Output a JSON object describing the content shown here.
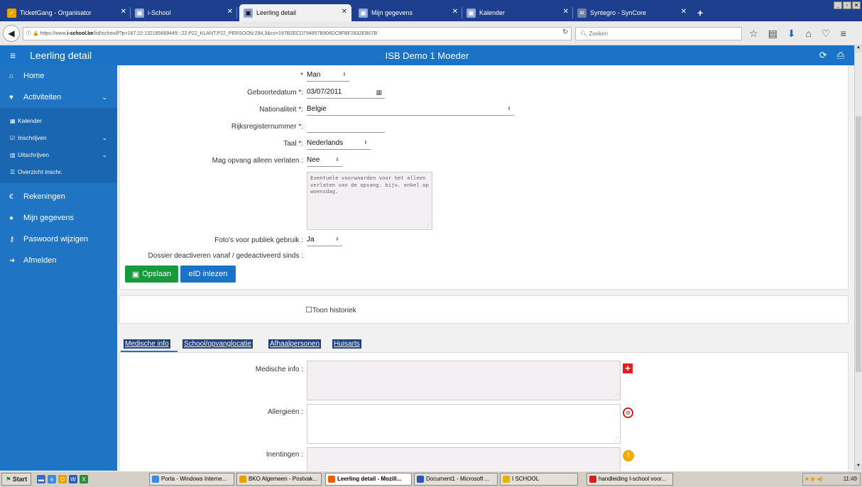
{
  "browser": {
    "tabs": [
      {
        "label": "TicketGang - Organisator"
      },
      {
        "label": "i-School"
      },
      {
        "label": "Leerling detail"
      },
      {
        "label": "Mijn gegevens"
      },
      {
        "label": "Kalender"
      },
      {
        "label": "Syntegro - SynCore"
      }
    ],
    "new_tab": "+",
    "url_prefix": "https://www.",
    "url_domain": "i-school.be",
    "url_rest": "/lid/ischool/f?p=167:22:132185669449:::22:P22_KLANT,P22_PERSOON:294,3&cs=197B2ECD794857B906DC9FBF2832EB07B",
    "search_placeholder": "Zoeken"
  },
  "appbar": {
    "title": "Leerling detail",
    "center": "ISB Demo 1 Moeder"
  },
  "sidebar": {
    "items": [
      {
        "label": "Home"
      },
      {
        "label": "Activiteiten"
      },
      {
        "label": "Rekeningen"
      },
      {
        "label": "Mijn gegevens"
      },
      {
        "label": "Paswoord wijzigen"
      },
      {
        "label": "Afmelden"
      }
    ],
    "subitems": [
      {
        "label": "Kalender"
      },
      {
        "label": "Inschrijven"
      },
      {
        "label": "Uitschrijven"
      },
      {
        "label": "Overzicht inschr."
      }
    ]
  },
  "form": {
    "gender_label": "*",
    "gender_value": "Man",
    "birth_label": "Geboortedatum *:",
    "birth_value": "03/07/2011",
    "nat_label": "Nationaliteit *:",
    "nat_value": "Belgie",
    "rrn_label": "Rijksregisternummer *:",
    "rrn_value": "",
    "lang_label": "Taal *:",
    "lang_value": "Nederlands",
    "leave_label": "Mag opvang alleen verlaten :",
    "leave_value": "Nee",
    "leave_placeholder": "Eventuele voorwaarden voor het alleen verlaten van de opvang. bijv. enkel op woensdag.",
    "photo_label": "Foto's voor publiek gebruik :",
    "photo_value": "Ja",
    "dossier_label": "Dossier deactiveren vanaf / gedeactiveerd sinds :",
    "save_btn": "Opslaan",
    "eid_btn": "eID inlezen",
    "history_label": "Toon historiek"
  },
  "medtabs": [
    {
      "label": "Medische info"
    },
    {
      "label": "School/opvanglocatie"
    },
    {
      "label": "Afhaalpersonen"
    },
    {
      "label": "Huisarts"
    }
  ],
  "medical": {
    "info_label": "Medische info :",
    "allergy_label": "Allergieën :",
    "vacc_label": "Inentingen :"
  },
  "taskbar": {
    "start": "Start",
    "buttons": [
      {
        "label": "Porta - Windows Interne..."
      },
      {
        "label": "BKO Algemeen - Postvak..."
      },
      {
        "label": "Leerling detail - Mozill..."
      },
      {
        "label": "Document1 - Microsoft ..."
      },
      {
        "label": "I SCHOOL"
      },
      {
        "label": "handleiding I-school voor..."
      }
    ],
    "clock": "11:49"
  },
  "colors": {
    "appbar": "#1a73c7",
    "sidebar": "#1f74c4",
    "save": "#169a3d",
    "eid": "#1a73c7"
  }
}
